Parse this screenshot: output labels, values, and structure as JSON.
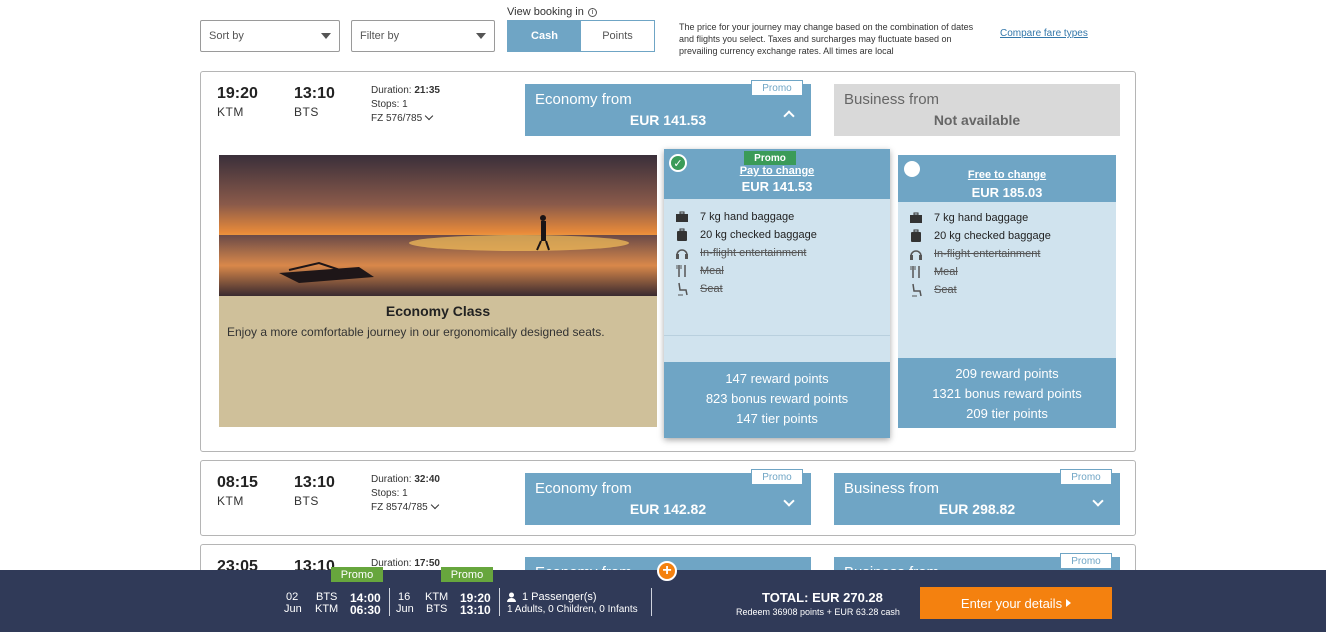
{
  "controls": {
    "sort_label": "Sort by",
    "filter_label": "Filter by",
    "view_booking_label": "View booking in",
    "view_options": [
      "Cash",
      "Points"
    ],
    "disclaimer": "The price for your journey may change based on the combination of dates and flights you select. Taxes and surcharges may fluctuate based on prevailing currency exchange rates. All times are local",
    "compare_link": "Compare fare types"
  },
  "flights": [
    {
      "depart_time": "19:20",
      "depart_airport": "KTM",
      "arrive_time": "13:10",
      "arrive_airport": "BTS",
      "duration_label": "Duration:",
      "duration": "21:35",
      "stops": "Stops: 1",
      "flight_no": "FZ 576/785",
      "economy": {
        "label": "Economy from",
        "price": "EUR 141.53",
        "promo": "Promo"
      },
      "business": {
        "label": "Business from",
        "price": "Not available"
      }
    },
    {
      "depart_time": "08:15",
      "depart_airport": "KTM",
      "arrive_time": "13:10",
      "arrive_airport": "BTS",
      "duration_label": "Duration:",
      "duration": "32:40",
      "stops": "Stops: 1",
      "flight_no": "FZ 8574/785",
      "economy": {
        "label": "Economy from",
        "price": "EUR 142.82",
        "promo": "Promo"
      },
      "business": {
        "label": "Business from",
        "price": "EUR 298.82",
        "promo": "Promo"
      }
    },
    {
      "depart_time": "23:05",
      "arrive_time": "13:10",
      "duration_label": "Duration:",
      "duration": "17:50",
      "economy": {
        "label": "Economy from"
      },
      "business": {
        "label": "Business from",
        "promo": "Promo"
      }
    }
  ],
  "expanded": {
    "class_title": "Economy Class",
    "class_desc": "Enjoy a more comfortable journey in our ergonomically designed seats.",
    "options": [
      {
        "promo": "Promo",
        "change_label": "Pay to change",
        "price": "EUR 141.53",
        "features": [
          "7 kg hand baggage",
          "20 kg checked baggage",
          "In-flight entertainment",
          "Meal",
          "Seat"
        ],
        "points": [
          "147 reward points",
          "823 bonus reward points",
          "147 tier points"
        ]
      },
      {
        "change_label": "Free to change",
        "price": "EUR 185.03",
        "features": [
          "7 kg hand baggage",
          "20 kg checked baggage",
          "In-flight entertainment",
          "Meal",
          "Seat"
        ],
        "points": [
          "209 reward points",
          "1321 bonus reward points",
          "209 tier points"
        ]
      }
    ]
  },
  "summary": {
    "leg1": {
      "day": "02",
      "month": "Jun",
      "from_code": "BTS",
      "to_code": "KTM",
      "dep": "14:00",
      "arr": "06:30",
      "promo": "Promo"
    },
    "leg2": {
      "day": "16",
      "month": "Jun",
      "from_code": "KTM",
      "to_code": "BTS",
      "dep": "19:20",
      "arr": "13:10",
      "promo": "Promo"
    },
    "passengers": "1 Passenger(s)",
    "passenger_detail": "1 Adults, 0 Children, 0 Infants",
    "total": "TOTAL: EUR 270.28",
    "redeem": "Redeem 36908 points + EUR 63.28 cash",
    "cta": "Enter your details"
  },
  "colors": {
    "accent": "#6fa5c5",
    "promo_green": "#3b9b58",
    "cta_orange": "#f4810f",
    "bar_navy": "#303a58"
  }
}
